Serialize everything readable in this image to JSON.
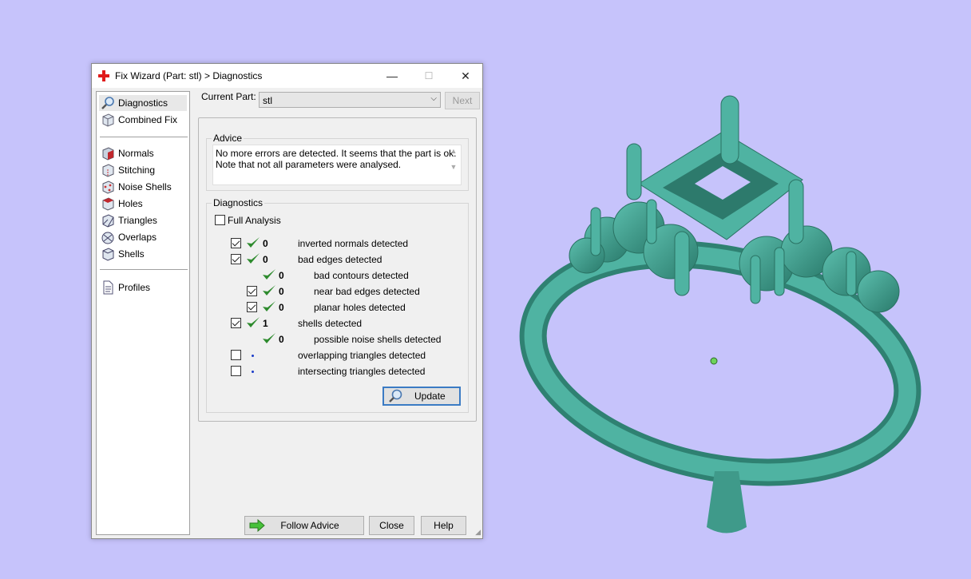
{
  "window": {
    "title": "Fix Wizard (Part: stl) > Diagnostics",
    "minimize": "—",
    "maximize": "☐",
    "close": "✕"
  },
  "sidebar": {
    "items": [
      {
        "label": "Diagnostics",
        "icon": "magnifier-icon"
      },
      {
        "label": "Combined Fix",
        "icon": "cube-icon"
      },
      {
        "label": "Normals",
        "icon": "normals-cube-icon"
      },
      {
        "label": "Stitching",
        "icon": "stitching-cube-icon"
      },
      {
        "label": "Noise Shells",
        "icon": "noise-shells-icon"
      },
      {
        "label": "Holes",
        "icon": "holes-cube-icon"
      },
      {
        "label": "Triangles",
        "icon": "triangles-cube-icon"
      },
      {
        "label": "Overlaps",
        "icon": "overlaps-icon"
      },
      {
        "label": "Shells",
        "icon": "shells-icon"
      },
      {
        "label": "Profiles",
        "icon": "profiles-document-icon"
      }
    ]
  },
  "current_part": {
    "label": "Current Part:",
    "value": "stl"
  },
  "next_button": "Next",
  "advice": {
    "title": "Advice",
    "line1": "No more errors are detected. It seems that the part is ok.",
    "line2": "Note that not all parameters were analysed."
  },
  "diagnostics": {
    "title": "Diagnostics",
    "full_analysis": "Full Analysis",
    "rows": [
      {
        "count": "0",
        "text": "inverted normals detected"
      },
      {
        "count": "0",
        "text": "bad edges detected"
      },
      {
        "count": "0",
        "text": "bad contours detected"
      },
      {
        "count": "0",
        "text": "near bad edges detected"
      },
      {
        "count": "0",
        "text": "planar holes detected"
      },
      {
        "count": "1",
        "text": "shells detected"
      },
      {
        "count": "0",
        "text": "possible noise shells detected"
      },
      {
        "count": "",
        "text": "overlapping triangles detected"
      },
      {
        "count": "",
        "text": "intersecting triangles detected"
      }
    ],
    "update_button": "Update"
  },
  "footer": {
    "follow_advice": "Follow Advice",
    "close": "Close",
    "help": "Help"
  },
  "colors": {
    "background": "#c6c3fb",
    "model": "#3f9a8a",
    "check": "#2e8b2e",
    "accent": "#3b7bc4"
  }
}
